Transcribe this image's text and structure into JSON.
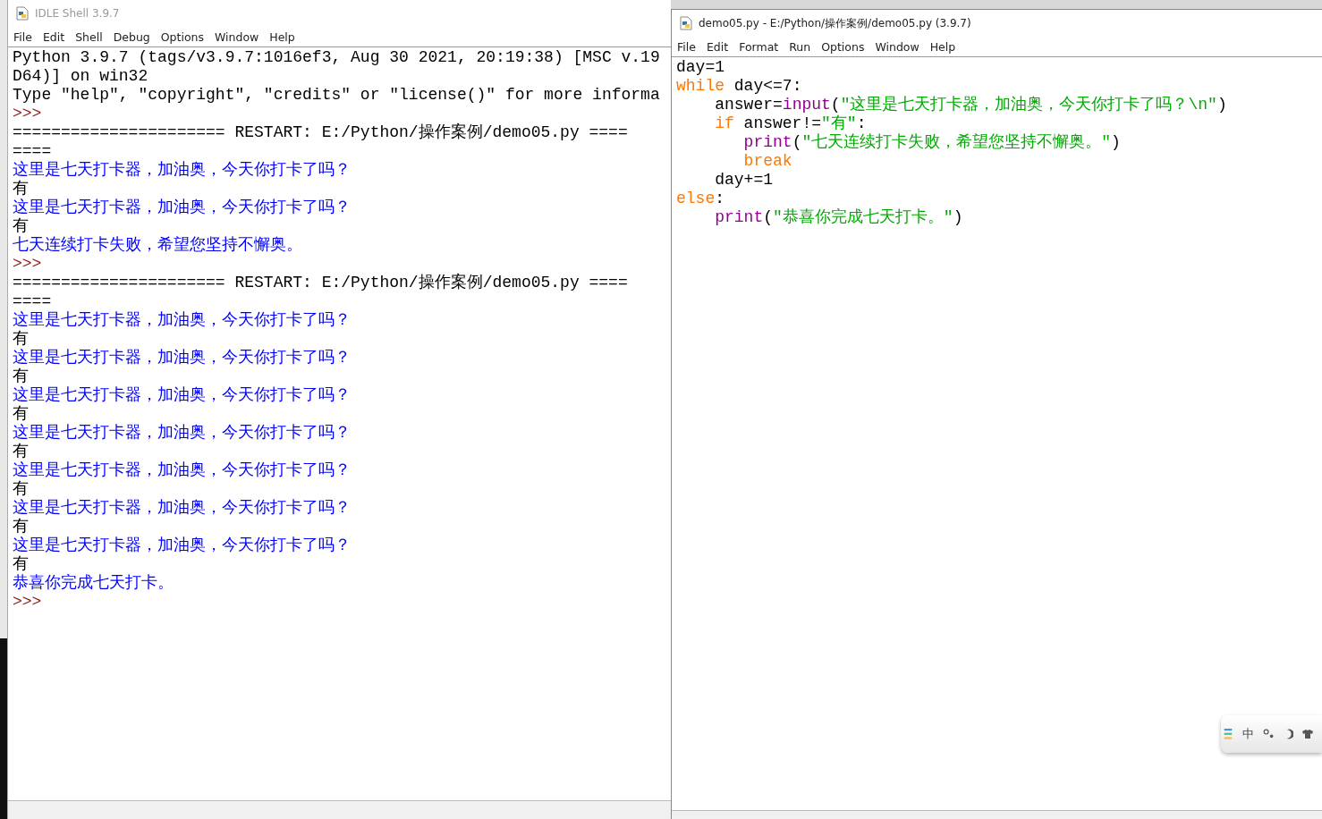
{
  "shell_window": {
    "title": "IDLE Shell 3.9.7",
    "menu": [
      "File",
      "Edit",
      "Shell",
      "Debug",
      "Options",
      "Window",
      "Help"
    ],
    "lines": [
      [
        {
          "kind": "plain",
          "text": "Python 3.9.7 (tags/v3.9.7:1016ef3, Aug 30 2021, 20:19:38) [MSC v.19"
        }
      ],
      [
        {
          "kind": "plain",
          "text": "D64)] on win32"
        }
      ],
      [
        {
          "kind": "plain",
          "text": "Type \"help\", \"copyright\", \"credits\" or \"license()\" for more informa"
        }
      ],
      [
        {
          "kind": "prompt",
          "text": ">>>"
        }
      ],
      [
        {
          "kind": "plain",
          "text": "====================== RESTART: E:/Python/操作案例/demo05.py ===="
        }
      ],
      [
        {
          "kind": "plain",
          "text": "===="
        }
      ],
      [
        {
          "kind": "output",
          "text": "这里是七天打卡器，加油奥，今天你打卡了吗？"
        }
      ],
      [
        {
          "kind": "input",
          "text": "有"
        }
      ],
      [
        {
          "kind": "output",
          "text": "这里是七天打卡器，加油奥，今天你打卡了吗？"
        }
      ],
      [
        {
          "kind": "input",
          "text": "有"
        }
      ],
      [
        {
          "kind": "output",
          "text": "七天连续打卡失败，希望您坚持不懈奥。"
        }
      ],
      [
        {
          "kind": "prompt",
          "text": ">>>"
        }
      ],
      [
        {
          "kind": "plain",
          "text": "====================== RESTART: E:/Python/操作案例/demo05.py ===="
        }
      ],
      [
        {
          "kind": "plain",
          "text": "===="
        }
      ],
      [
        {
          "kind": "output",
          "text": "这里是七天打卡器，加油奥，今天你打卡了吗？"
        }
      ],
      [
        {
          "kind": "input",
          "text": "有"
        }
      ],
      [
        {
          "kind": "output",
          "text": "这里是七天打卡器，加油奥，今天你打卡了吗？"
        }
      ],
      [
        {
          "kind": "input",
          "text": "有"
        }
      ],
      [
        {
          "kind": "output",
          "text": "这里是七天打卡器，加油奥，今天你打卡了吗？"
        }
      ],
      [
        {
          "kind": "input",
          "text": "有"
        }
      ],
      [
        {
          "kind": "output",
          "text": "这里是七天打卡器，加油奥，今天你打卡了吗？"
        }
      ],
      [
        {
          "kind": "input",
          "text": "有"
        }
      ],
      [
        {
          "kind": "output",
          "text": "这里是七天打卡器，加油奥，今天你打卡了吗？"
        }
      ],
      [
        {
          "kind": "input",
          "text": "有"
        }
      ],
      [
        {
          "kind": "output",
          "text": "这里是七天打卡器，加油奥，今天你打卡了吗？"
        }
      ],
      [
        {
          "kind": "input",
          "text": "有"
        }
      ],
      [
        {
          "kind": "output",
          "text": "这里是七天打卡器，加油奥，今天你打卡了吗？"
        }
      ],
      [
        {
          "kind": "input",
          "text": "有"
        }
      ],
      [
        {
          "kind": "output",
          "text": "恭喜你完成七天打卡。"
        }
      ],
      [
        {
          "kind": "prompt",
          "text": ">>>"
        }
      ]
    ]
  },
  "editor_window": {
    "title": "demo05.py - E:/Python/操作案例/demo05.py (3.9.7)",
    "menu": [
      "File",
      "Edit",
      "Format",
      "Run",
      "Options",
      "Window",
      "Help"
    ],
    "lines": [
      [
        {
          "kind": "plain",
          "text": "day=1"
        }
      ],
      [
        {
          "kind": "keyword",
          "text": "while"
        },
        {
          "kind": "plain",
          "text": " day<=7:"
        }
      ],
      [
        {
          "kind": "plain",
          "text": "    answer="
        },
        {
          "kind": "builtin",
          "text": "input"
        },
        {
          "kind": "plain",
          "text": "("
        },
        {
          "kind": "string",
          "text": "\"这里是七天打卡器，加油奥，今天你打卡了吗？\\n\""
        },
        {
          "kind": "plain",
          "text": ")"
        }
      ],
      [
        {
          "kind": "keyword",
          "text": "    if"
        },
        {
          "kind": "plain",
          "text": " answer!="
        },
        {
          "kind": "string",
          "text": "\"有\""
        },
        {
          "kind": "plain",
          "text": ":"
        }
      ],
      [
        {
          "kind": "builtin",
          "text": "       print"
        },
        {
          "kind": "plain",
          "text": "("
        },
        {
          "kind": "string",
          "text": "\"七天连续打卡失败，希望您坚持不懈奥。\""
        },
        {
          "kind": "plain",
          "text": ")"
        }
      ],
      [
        {
          "kind": "keyword",
          "text": "       break"
        }
      ],
      [
        {
          "kind": "plain",
          "text": "    day+=1"
        }
      ],
      [
        {
          "kind": "keyword",
          "text": "else"
        },
        {
          "kind": "plain",
          "text": ":"
        }
      ],
      [
        {
          "kind": "builtin",
          "text": "    print"
        },
        {
          "kind": "plain",
          "text": "("
        },
        {
          "kind": "string",
          "text": "\"恭喜你完成七天打卡。\""
        },
        {
          "kind": "plain",
          "text": ")"
        }
      ]
    ]
  },
  "ime_toolbar": {
    "mode": "中"
  }
}
